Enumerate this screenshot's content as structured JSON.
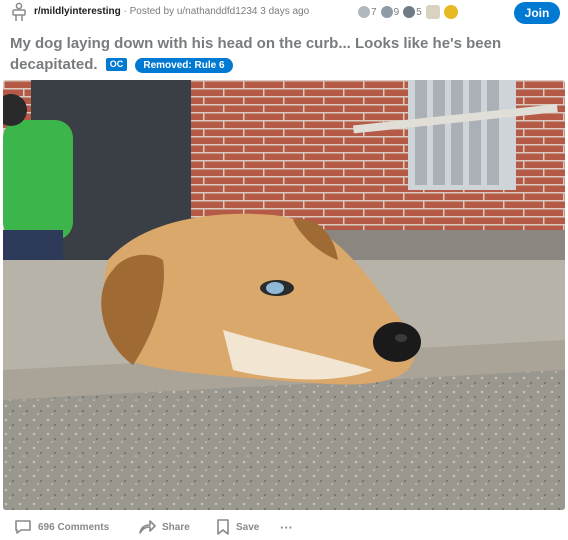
{
  "post": {
    "subreddit": "r/mildlyinteresting",
    "separator": "·",
    "posted_by": "Posted by u/nathanddfd1234 3 days ago",
    "awards": [
      {
        "icon": "silver-award-icon",
        "count": "7",
        "color": "#9aa7b4"
      },
      {
        "icon": "gold-award-icon",
        "count": "9",
        "color": "#8e9aa6"
      },
      {
        "icon": "platinum-award-icon",
        "count": "5",
        "color": "#6f7c88"
      }
    ],
    "title": "My dog laying down with his head on the curb... Looks like he's been decapitated.",
    "flair_oc": "OC",
    "flair_removed": "Removed: Rule 6",
    "image_alt_icon": "dog-head-on-curb-photo"
  },
  "join_label": "Join",
  "footer": {
    "comments": "696 Comments",
    "share": "Share",
    "save": "Save",
    "more": "···"
  },
  "colors": {
    "accent": "#0079d3",
    "muted": "#787c7e"
  }
}
